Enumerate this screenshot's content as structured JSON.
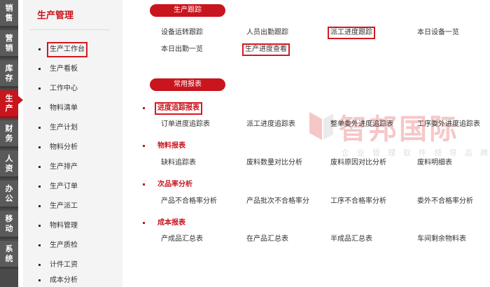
{
  "rail": {
    "items": [
      {
        "c1": "销",
        "c2": "售"
      },
      {
        "c1": "营",
        "c2": "销"
      },
      {
        "c1": "库",
        "c2": "存"
      },
      {
        "c1": "生",
        "c2": "产"
      },
      {
        "c1": "财",
        "c2": "务"
      },
      {
        "c1": "人",
        "c2": "资"
      },
      {
        "c1": "办",
        "c2": "公"
      },
      {
        "c1": "移",
        "c2": "动"
      },
      {
        "c1": "系",
        "c2": "统"
      }
    ],
    "active_index": 3
  },
  "submenu": {
    "title": "生产管理",
    "items": [
      {
        "label": "生产工作台"
      },
      {
        "label": "生产看板"
      },
      {
        "label": "工作中心"
      },
      {
        "label": "物料清单"
      },
      {
        "label": "生产计划"
      },
      {
        "label": "物料分析"
      },
      {
        "label": "生产排产"
      },
      {
        "label": "生产订单"
      },
      {
        "label": "生产派工"
      },
      {
        "label": "物料管理"
      },
      {
        "label": "生产质检"
      },
      {
        "label": "计件工资"
      },
      {
        "label": "成本分析"
      }
    ]
  },
  "tracking": {
    "pill": "生产跟踪",
    "links": [
      "设备运转跟踪",
      "人员出勤跟踪",
      "派工进度跟踪",
      "本日设备一览",
      "本日出勤一览",
      "生产进度查看"
    ]
  },
  "reports": {
    "pill": "常用报表",
    "sections": [
      {
        "heading": "进度追踪报表",
        "links": [
          "订单进度追踪表",
          "派工进度追踪表",
          "整单委外进度追踪表",
          "工序委外进度追踪表"
        ]
      },
      {
        "heading": "物料报表",
        "links": [
          "缺料追踪表",
          "废料数量对比分析",
          "废料原因对比分析",
          "废料明细表"
        ]
      },
      {
        "heading": "次品率分析",
        "links": [
          "产品不合格率分析",
          "产品批次不合格率分",
          "工序不合格率分析",
          "委外不合格率分析"
        ]
      },
      {
        "heading": "成本报表",
        "links": [
          "产成品汇总表",
          "在产品汇总表",
          "半成品汇总表",
          "车间剩余物料表"
        ]
      }
    ]
  },
  "watermark": {
    "name": "智邦国际",
    "slogan": "企业管理软件领导品牌"
  },
  "colors": {
    "accent": "#c9151e",
    "highlight_box": "#d21920",
    "rail_bg": "#4a4a4a",
    "submenu_bg": "#f4f4f4"
  }
}
